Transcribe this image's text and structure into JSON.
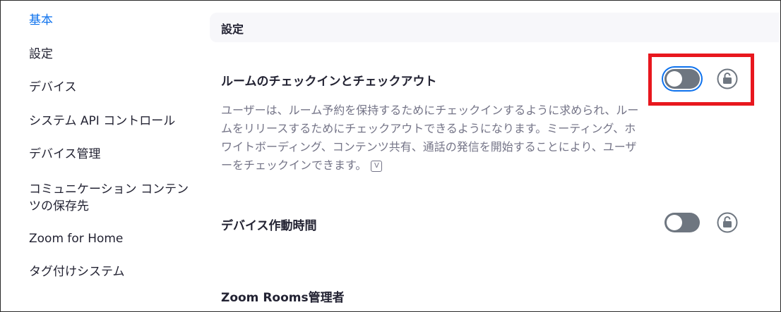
{
  "sidebar": {
    "items": [
      {
        "label": "基本",
        "active": true
      },
      {
        "label": "設定"
      },
      {
        "label": "デバイス"
      },
      {
        "label": "システム API コントロール"
      },
      {
        "label": "デバイス管理"
      },
      {
        "label": "コミュニケーション コンテンツの保存先"
      },
      {
        "label": "Zoom for Home"
      },
      {
        "label": "タグ付けシステム"
      }
    ]
  },
  "section": {
    "title": "設定"
  },
  "settings": [
    {
      "title": "ルームのチェックインとチェックアウト",
      "description": "ユーザーは、ルーム予約を保持するためにチェックインするように求められ、ルームをリリースするためにチェックアウトできるようになります。ミーティング、ホワイトボーディング、コンテンツ共有、通話の発信を開始することにより、ユーザーをチェックインできます。",
      "enabled": false,
      "locked": false
    },
    {
      "title": "デバイス作動時間",
      "enabled": false,
      "locked": false
    },
    {
      "title": "Zoom Rooms管理者"
    }
  ],
  "colors": {
    "accent": "#0e72ed",
    "highlight": "#e8171e",
    "toggle_off": "#6e7680"
  },
  "icons": {
    "lock": "unlock-icon",
    "info": "info-icon"
  }
}
